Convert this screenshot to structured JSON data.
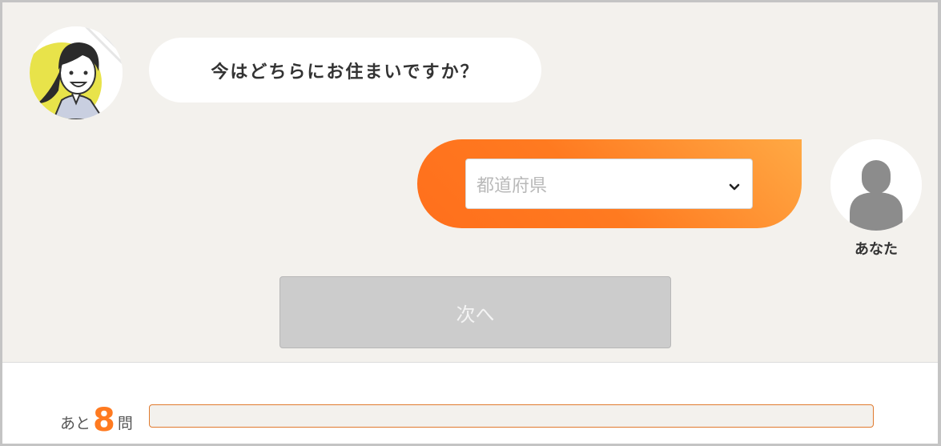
{
  "chat": {
    "question": "今はどちらにお住まいですか？",
    "operator_avatar_icon": "operator-avatar-icon",
    "user_avatar_icon": "user-silhouette-icon",
    "user_label": "あなた"
  },
  "answer": {
    "select_placeholder": "都道府県",
    "select_icon": "chevron-down-icon"
  },
  "next_button": {
    "label": "次へ",
    "enabled": false
  },
  "progress": {
    "prefix": "あと",
    "remaining": "8",
    "suffix": "問",
    "fill_fraction": 0
  },
  "colors": {
    "accent": "#ff7a20",
    "accent_light": "#ffa944",
    "background": "#f3f1ed",
    "button_disabled": "#cccccc",
    "text": "#333333"
  }
}
